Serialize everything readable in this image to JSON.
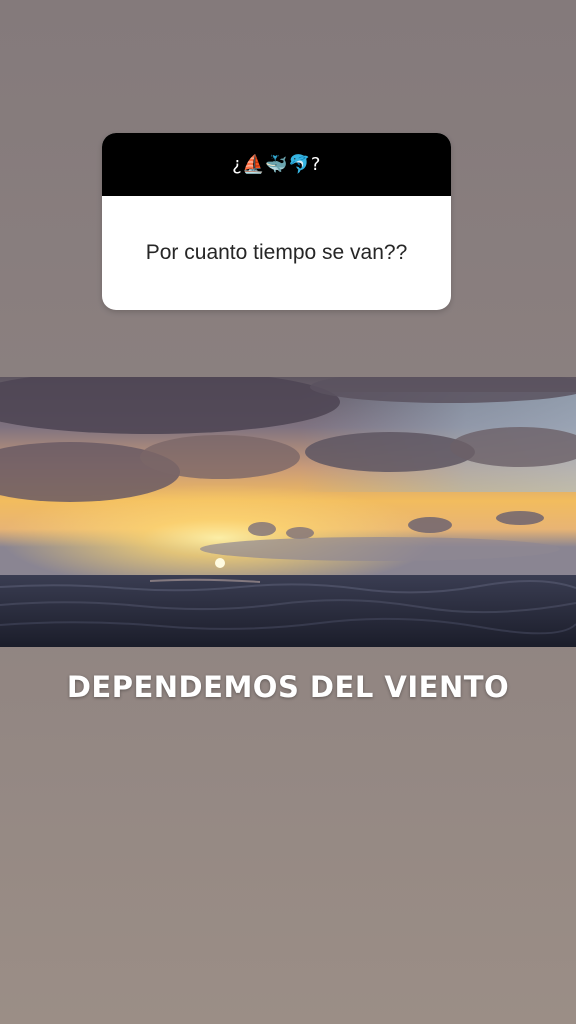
{
  "question_sticker": {
    "header": "¿⛵🐳🐬?",
    "question": "Por cuanto tiempo se van??"
  },
  "photo": {
    "subject": "sunset-over-ocean"
  },
  "caption": {
    "text": "DEPENDEMOS DEL VIENTO"
  },
  "colors": {
    "background_top": "#847a7b",
    "background_bottom": "#9b8e86",
    "sticker_header": "#000000",
    "sticker_body": "#ffffff",
    "caption_text": "#ffffff"
  }
}
